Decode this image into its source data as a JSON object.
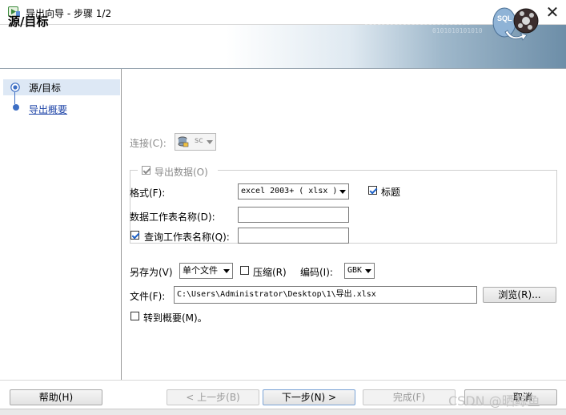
{
  "window": {
    "title": "导出向导 - 步骤 1/2",
    "close_glyph": "✕"
  },
  "header": {
    "title": "源/目标",
    "binary_deco": "0101010101010101010101010",
    "binary_deco2": "0101010101010",
    "graphic_icon": "sql-database-export-icon"
  },
  "steps": [
    {
      "label": "源/目标",
      "active": true
    },
    {
      "label": "导出概要",
      "active": false
    }
  ],
  "form": {
    "connection_label": "连接(C):",
    "connection_value": "sc",
    "export_data_label": "导出数据(O)",
    "format_label": "格式(F):",
    "format_value": "excel 2003+ ( xlsx )",
    "title_checkbox_label": "标题",
    "data_sheet_label": "数据工作表名称(D):",
    "data_sheet_value": "",
    "query_sheet_label": "查询工作表名称(Q):",
    "query_sheet_value": "",
    "save_as_label": "另存为(V)",
    "save_as_value": "单个文件",
    "compress_label": "压缩(R)",
    "encoding_label": "编码(I):",
    "encoding_value": "GBK",
    "file_label": "文件(F):",
    "file_value": "C:\\Users\\Administrator\\Desktop\\1\\导出.xlsx",
    "browse_label": "浏览(R)...",
    "goto_summary_label": "转到概要(M)。"
  },
  "footer": {
    "help_label": "帮助(H)",
    "back_label": "< 上一步(B)",
    "next_label": "下一步(N) >",
    "finish_label": "完成(F)",
    "cancel_label": "取消"
  },
  "watermark": "CSDN @晒鲸鱼",
  "colors": {
    "accent": "#3c6ec4",
    "step_highlight": "#dde8f5",
    "check_blue": "#1f62c8"
  }
}
